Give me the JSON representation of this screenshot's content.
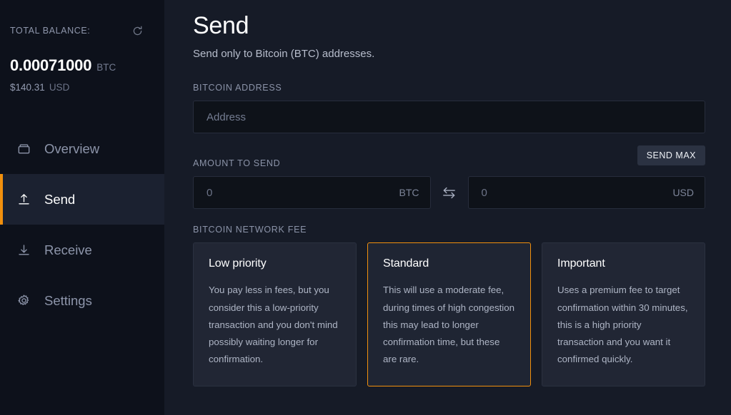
{
  "sidebar": {
    "balance": {
      "label": "TOTAL BALANCE:",
      "refresh_icon": "refresh-icon",
      "amount": "0.00071000",
      "unit": "BTC",
      "fiat_amount": "$140.31",
      "fiat_unit": "USD"
    },
    "items": [
      {
        "label": "Overview",
        "icon": "wallet-icon",
        "active": false
      },
      {
        "label": "Send",
        "icon": "upload-arrow-icon",
        "active": true
      },
      {
        "label": "Receive",
        "icon": "download-arrow-icon",
        "active": false
      },
      {
        "label": "Settings",
        "icon": "gear-icon",
        "active": false
      }
    ]
  },
  "main": {
    "title": "Send",
    "subtitle": "Send only to Bitcoin (BTC) addresses.",
    "address": {
      "label": "BITCOIN ADDRESS",
      "placeholder": "Address",
      "value": ""
    },
    "amount": {
      "label": "AMOUNT TO SEND",
      "send_max_label": "SEND MAX",
      "crypto": {
        "placeholder": "0",
        "value": "",
        "suffix": "BTC"
      },
      "fiat": {
        "placeholder": "0",
        "value": "",
        "suffix": "USD"
      },
      "swap_icon": "swap-arrows-icon"
    },
    "fee": {
      "label": "BITCOIN NETWORK FEE",
      "options": [
        {
          "title": "Low priority",
          "description": "You pay less in fees, but you consider this a low-priority transaction and you don't mind possibly waiting longer for confirmation.",
          "selected": false
        },
        {
          "title": "Standard",
          "description": "This will use a moderate fee, during times of high congestion this may lead to longer confirmation time, but these are rare.",
          "selected": true
        },
        {
          "title": "Important",
          "description": "Uses a premium fee to target confirmation within 30 minutes, this is a high priority transaction and you want it confirmed quickly.",
          "selected": false
        }
      ]
    }
  },
  "colors": {
    "accent_orange": "#f2900d",
    "sidebar_bg": "#0d111b",
    "main_bg": "#161b27",
    "card_bg": "#212634",
    "input_bg": "#0e1219"
  }
}
